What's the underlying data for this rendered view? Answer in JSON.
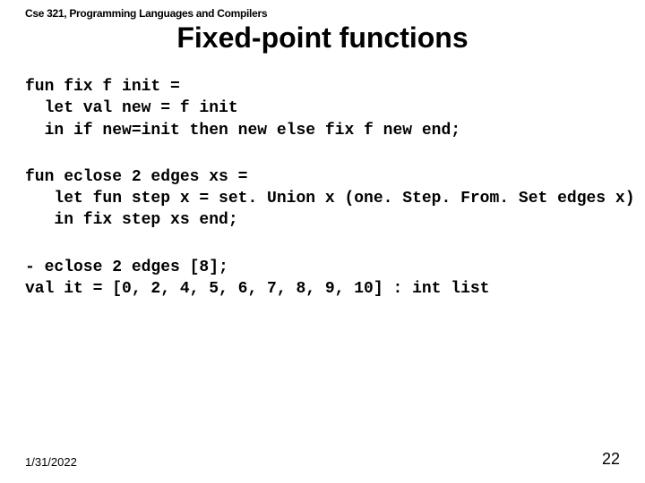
{
  "course_header": "Cse 321, Programming Languages and Compilers",
  "title": "Fixed-point functions",
  "code1": "fun fix f init =\n  let val new = f init\n  in if new=init then new else fix f new end;",
  "code2": "fun eclose 2 edges xs =\n   let fun step x = set. Union x (one. Step. From. Set edges x)\n   in fix step xs end;",
  "code3": "- eclose 2 edges [8];\nval it = [0, 2, 4, 5, 6, 7, 8, 9, 10] : int list",
  "footer_date": "1/31/2022",
  "footer_page": "22"
}
